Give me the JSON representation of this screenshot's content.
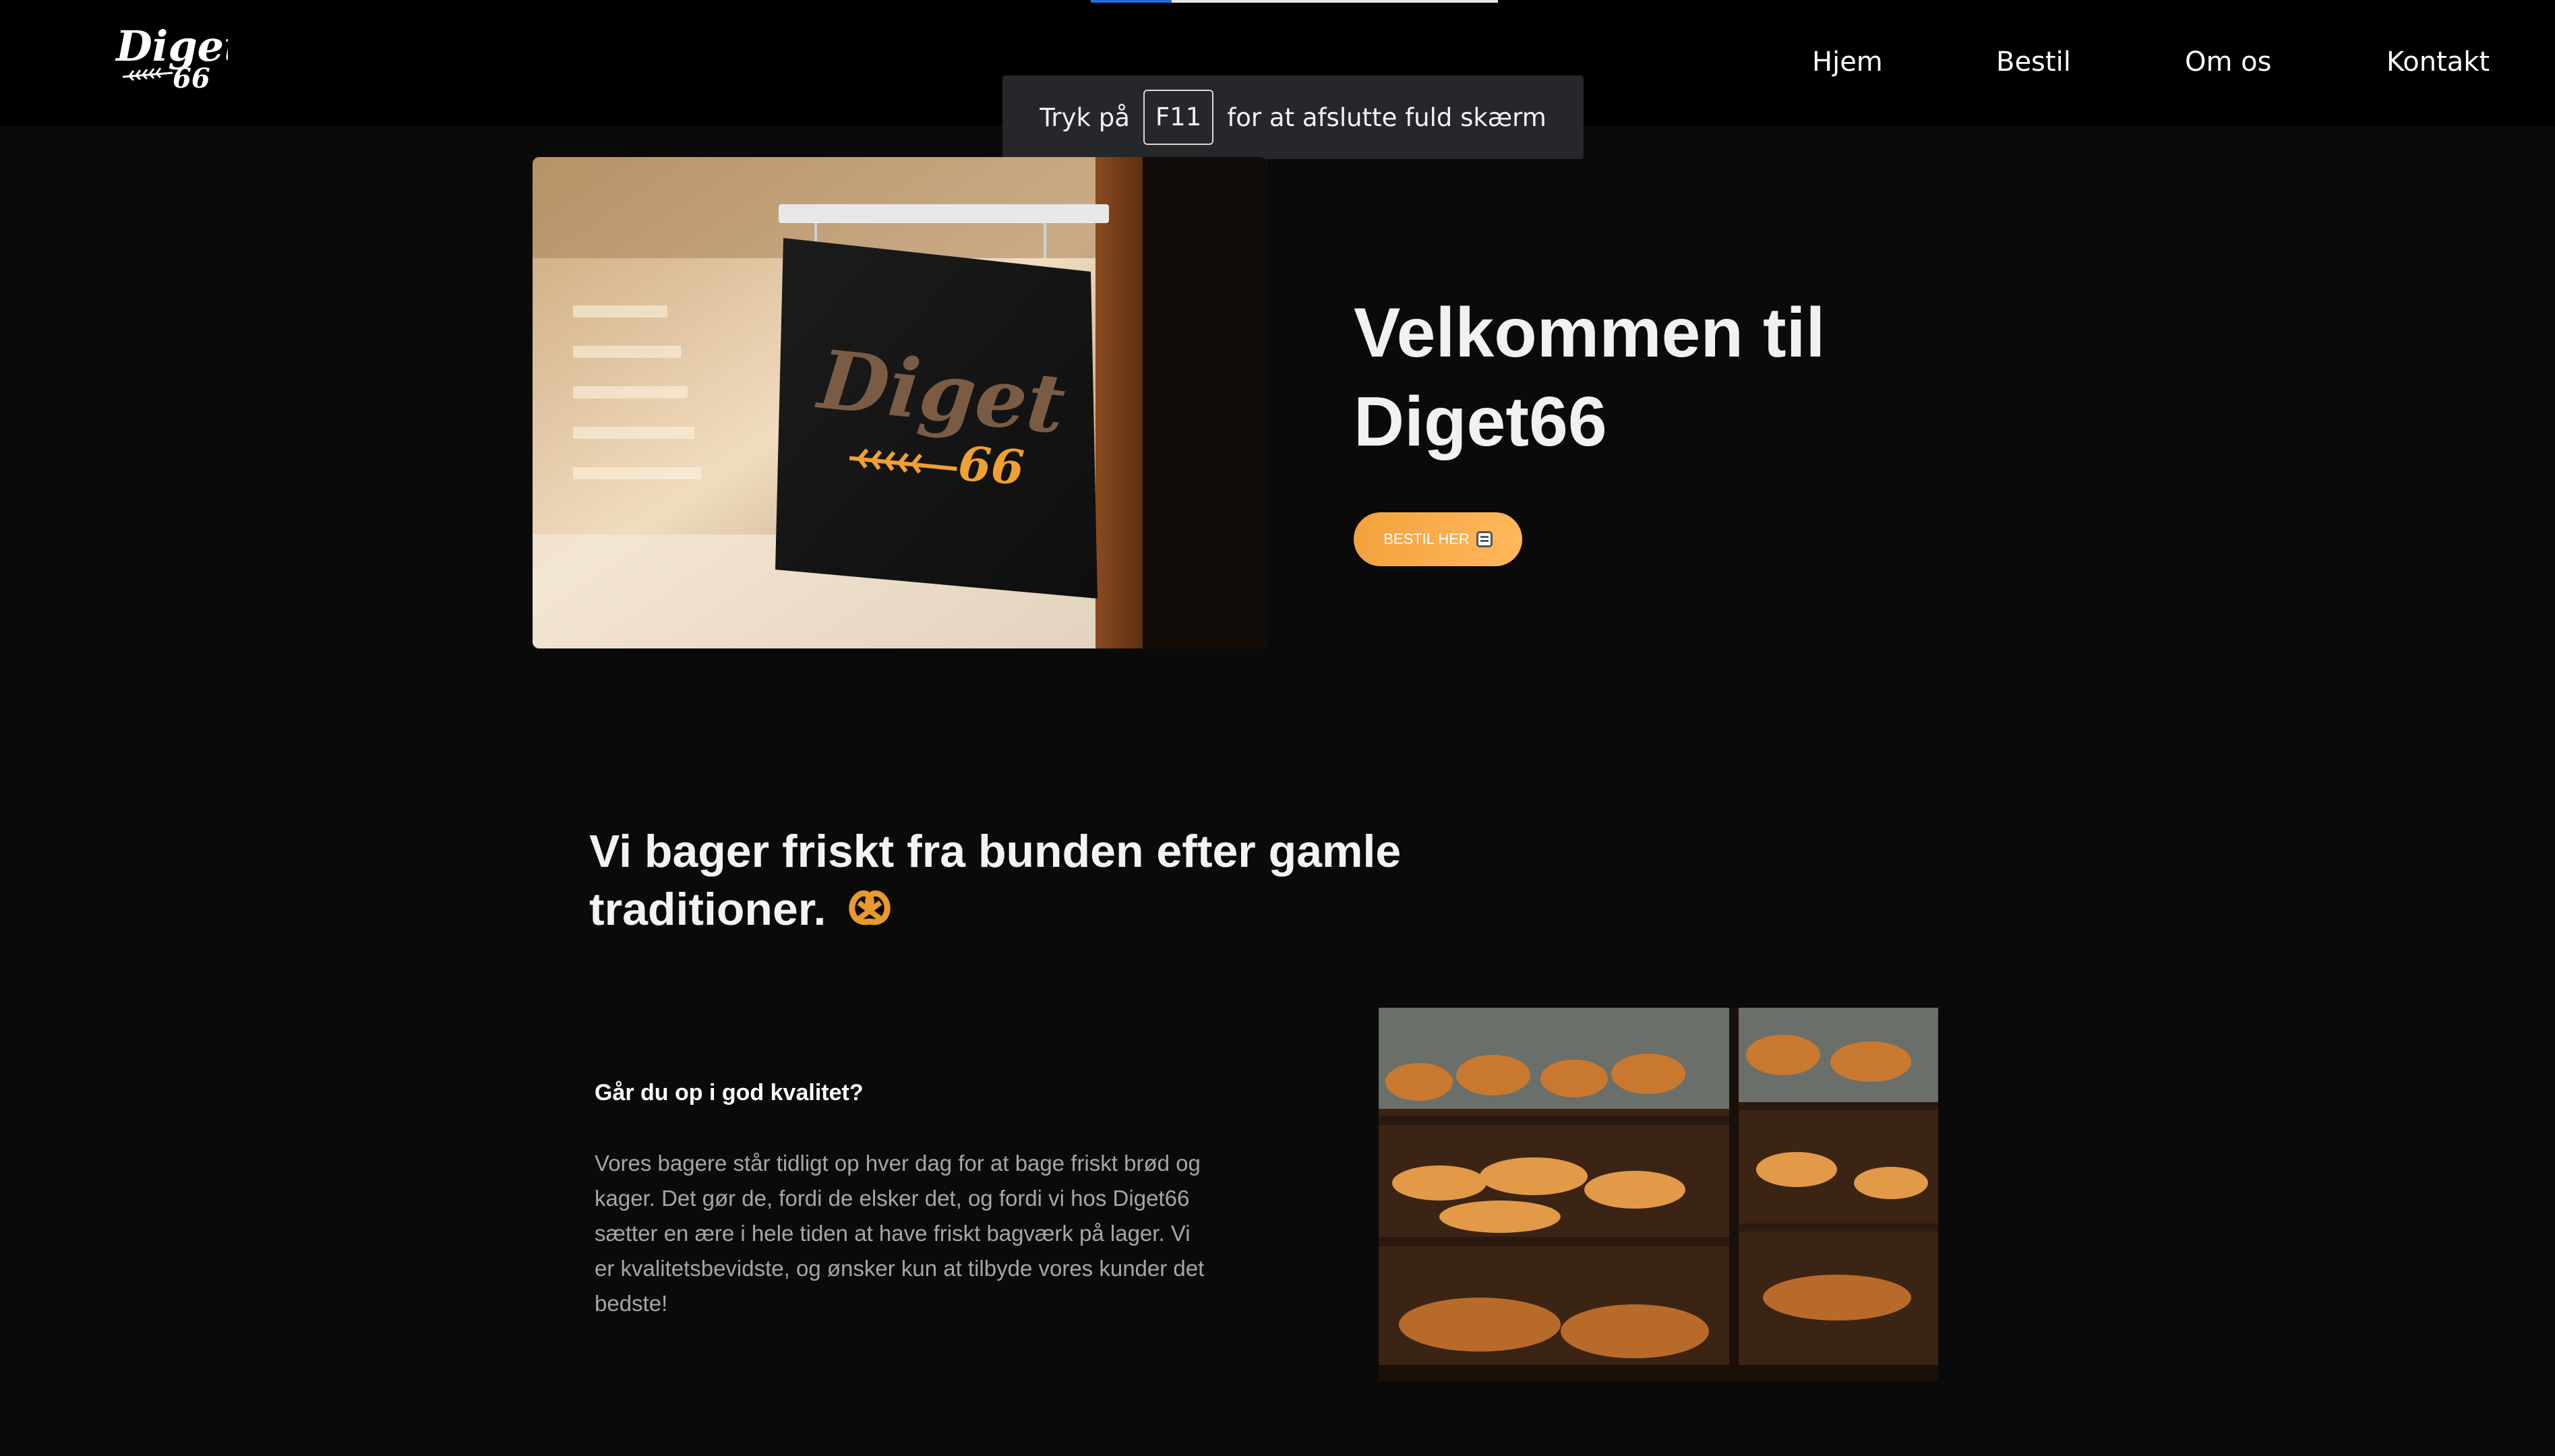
{
  "brand": {
    "logo_line1": "Diget",
    "logo_line2": "66",
    "accent_color": "#f5a23e"
  },
  "nav": {
    "items": [
      {
        "label": "Hjem"
      },
      {
        "label": "Bestil"
      },
      {
        "label": "Om os"
      },
      {
        "label": "Kontakt"
      }
    ]
  },
  "fullscreen_notice": {
    "prefix": "Tryk på",
    "key": "F11",
    "suffix": "for at afslutte fuld skærm"
  },
  "hero": {
    "image_icon": "storefront-sign-photo",
    "sign_text_line1": "Diget",
    "sign_text_line2": "66",
    "title": "Velkommen til Diget66",
    "button_label": "BESTIL HER",
    "button_icon": "notepad-icon"
  },
  "about": {
    "heading": "Vi bager friskt fra bunden efter gamle traditioner.",
    "heading_icon": "pretzel-icon",
    "subheading": "Går du op i god kvalitet?",
    "body": "Vores bagere står tidligt op hver dag for at bage friskt brød og kager. Det gør de, fordi de elsker det, og fordi vi hos Diget66 sætter en ære i hele tiden at have friskt bagværk på lager. Vi er kvalitetsbevidste, og ønsker kun at tilbyde vores kunder det bedste!",
    "image_icon": "bakery-display-case-photo"
  }
}
